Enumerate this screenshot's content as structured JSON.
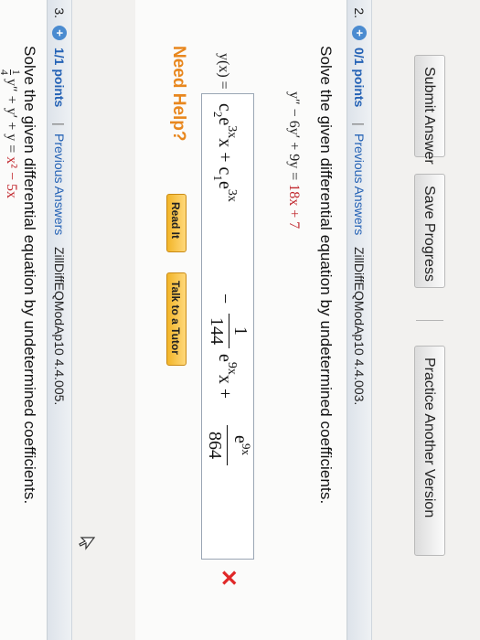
{
  "toolbar": {
    "submit_label": "Submit Answer",
    "save_label": "Save Progress",
    "practice_label": "Practice Another Version"
  },
  "q2": {
    "number": "2.",
    "points": "0/1 points",
    "separator": "|",
    "prev_label": "Previous Answers",
    "id": "ZillDiffEQModAp10 4.4.003.",
    "prompt": "Solve the given differential equation by undetermined coefficients.",
    "eq_left": "y″ − 6y′ + 9y =",
    "eq_right": "18x + 7",
    "answer_label": "y(x) =",
    "answer": {
      "t1": "c",
      "t1_sub": "2",
      "t1_e": "e",
      "t1_sup": "3x",
      "t1_tail": "x + c",
      "t2_sub": "1",
      "t2_e": "e",
      "t2_sup": "3x",
      "minus": "−",
      "frac1_num": "1",
      "frac1_den": "144",
      "t3_e": "e",
      "t3_sup": "9x",
      "t3_tail": "x +",
      "frac2_num_e": "e",
      "frac2_num_sup": "9x",
      "frac2_den": "864"
    },
    "status_mark": "✕",
    "help_label": "Need Help?",
    "readit_label": "Read It",
    "tutor_label": "Talk to a Tutor"
  },
  "q3": {
    "number": "3.",
    "points": "1/1 points",
    "separator": "|",
    "prev_label": "Previous Answers",
    "id": "ZillDiffEQModAp10 4.4.005.",
    "prompt": "Solve the given differential equation by undetermined coefficients.",
    "eq_frac_num": "1",
    "eq_frac_den": "4",
    "eq_left": "y″ + y′ + y =",
    "eq_right": "x² − 5x"
  }
}
